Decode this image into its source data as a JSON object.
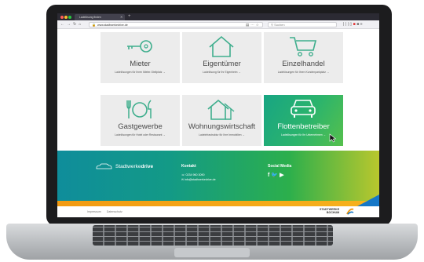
{
  "browser": {
    "tab_title": "Ladelösung finden",
    "url": "www.stadtwerkedrive.de",
    "search_placeholder": "Suchen"
  },
  "tiles": [
    {
      "id": "mieter",
      "title": "Mieter",
      "subtitle": "Ladelösungen für Ihren Mieter-Stellplatz →",
      "icon": "key-icon"
    },
    {
      "id": "eigentuemer",
      "title": "Eigentümer",
      "subtitle": "Ladelösung für Ihr Eigenheim →",
      "icon": "house-icon"
    },
    {
      "id": "einzelhandel",
      "title": "Einzelhandel",
      "subtitle": "Ladelösungen für Ihren Kundenparkplatz →",
      "icon": "shopping-cart-icon"
    },
    {
      "id": "gastgewerbe",
      "title": "Gastgewerbe",
      "subtitle": "Ladelösungen für Hotel oder Restaurant →",
      "icon": "cutlery-icon"
    },
    {
      "id": "wohnungswirtschaft",
      "title": "Wohnungswirtschaft",
      "subtitle": "Ladeinfrastruktur für Ihre Immobilien →",
      "icon": "apartment-icon"
    },
    {
      "id": "flottenbetreiber",
      "title": "Flottenbetreiber",
      "subtitle": "Ladelösungen für Ihr Unternehmen →",
      "icon": "car-icon",
      "active": true
    }
  ],
  "footer": {
    "brand_prefix": "Stadtwerke",
    "brand_suffix": "drive",
    "kontakt_title": "Kontakt",
    "phone": "0234 960 3090",
    "email": "info@stadtwerkedrive.de",
    "social_title": "Social Media",
    "social_icons": [
      "facebook-icon",
      "twitter-icon",
      "youtube-icon"
    ]
  },
  "legal": {
    "impressum": "Impressum",
    "datenschutz": "Datenschutz"
  },
  "logo": {
    "line1": "STADTWERKE",
    "line2": "BOCHUM"
  },
  "colors": {
    "active_tile": "#2cb46c",
    "footer_start": "#0f8d9b",
    "footer_end": "#b9c72d",
    "orange": "#f29a12",
    "blue": "#1577c7"
  }
}
